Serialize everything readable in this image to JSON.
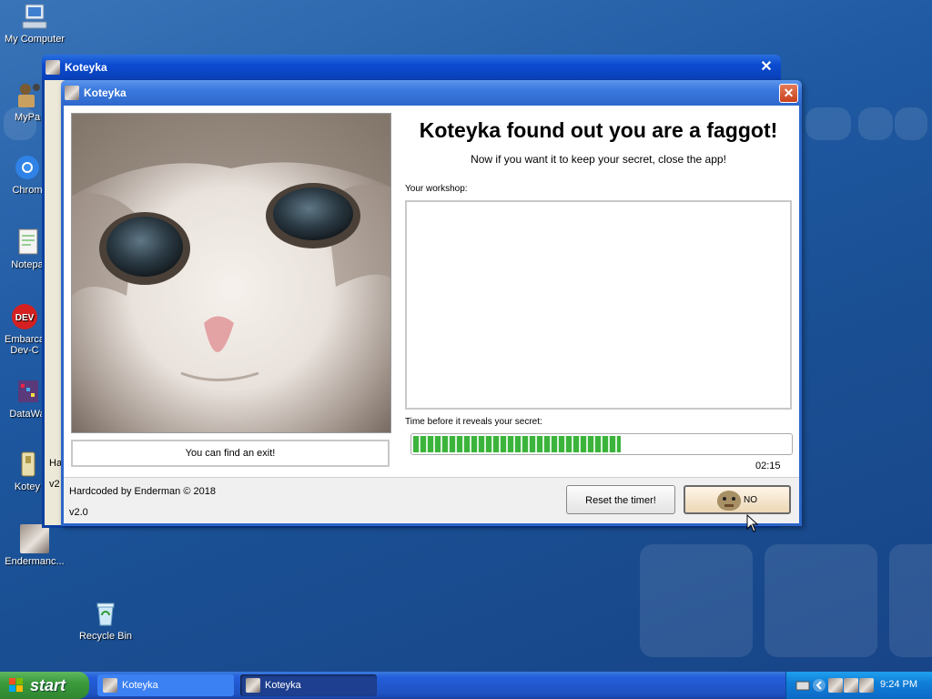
{
  "desktop": {
    "icons": [
      {
        "label": "My Computer",
        "icon": "computer-icon"
      },
      {
        "label": "MyPa",
        "icon": "folder-shortcut-icon"
      },
      {
        "label": "Chrom",
        "icon": "chrome-icon"
      },
      {
        "label": "Notepa",
        "icon": "notepad-icon"
      },
      {
        "label": "Embarca Dev-C",
        "icon": "devcpp-icon"
      },
      {
        "label": "DataWa",
        "icon": "datawave-icon"
      },
      {
        "label": "Kotey",
        "icon": "koteyka-exe-icon"
      },
      {
        "label": "Endermanc...",
        "icon": "cat-photo-icon"
      },
      {
        "label": "Recycle Bin",
        "icon": "recycle-bin-icon"
      }
    ]
  },
  "back_window": {
    "title": "Koteyka",
    "close_symbol": "✕",
    "peek_lines": [
      "Ha",
      "v2"
    ]
  },
  "front_window": {
    "title": "Koteyka",
    "close_symbol": "✕",
    "hint": "You can find an exit!",
    "headline": "Koteyka found out you are a faggot!",
    "subline": "Now if you want it to keep your secret, close the app!",
    "workshop_label": "Your workshop:",
    "workshop_value": "",
    "timer_label": "Time before it reveals your secret:",
    "progress_fraction": 0.55,
    "timer_value": "02:15",
    "credit": "Hardcoded by Enderman © 2018",
    "version": "v2.0",
    "reset_button": "Reset the timer!",
    "no_button": "NO"
  },
  "taskbar": {
    "start_label": "start",
    "tasks": [
      {
        "label": "Koteyka",
        "active": false
      },
      {
        "label": "Koteyka",
        "active": true
      }
    ],
    "clock": "9:24 PM"
  },
  "colors": {
    "desktop": "#1f5aa3",
    "titlebar_active": "#3a78de",
    "progress_green": "#3cb43c",
    "start_green": "#3c9a3c"
  }
}
